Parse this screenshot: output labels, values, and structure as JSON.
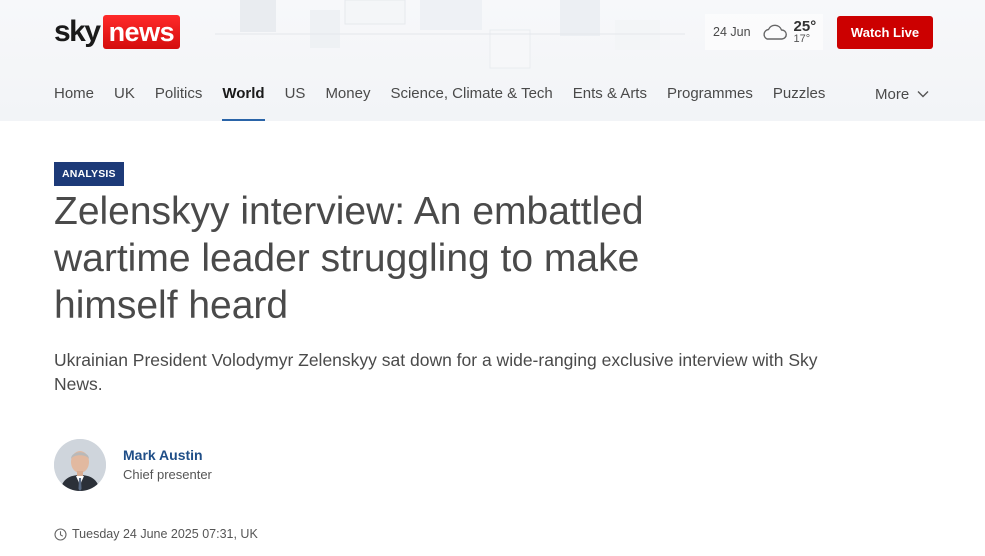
{
  "brand": {
    "logo_sky": "sky",
    "logo_news": "news",
    "accent_red": "#cc0000",
    "navy": "#1d3a78"
  },
  "weather": {
    "date": "24 Jun",
    "icon": "cloud-icon",
    "high": "25°",
    "low": "17°"
  },
  "header": {
    "watch_live_label": "Watch Live"
  },
  "nav": {
    "items": [
      {
        "label": "Home"
      },
      {
        "label": "UK"
      },
      {
        "label": "Politics"
      },
      {
        "label": "World",
        "active": true
      },
      {
        "label": "US"
      },
      {
        "label": "Money"
      },
      {
        "label": "Science, Climate & Tech"
      },
      {
        "label": "Ents & Arts"
      },
      {
        "label": "Programmes"
      },
      {
        "label": "Puzzles"
      }
    ],
    "more_label": "More"
  },
  "article": {
    "badge": "ANALYSIS",
    "headline": "Zelenskyy interview: An embattled wartime leader struggling to make himself heard",
    "standfirst": "Ukrainian President Volodymyr Zelenskyy sat down for a wide-ranging exclusive interview with Sky News.",
    "author": {
      "name": "Mark Austin",
      "role": "Chief presenter"
    },
    "timestamp": "Tuesday 24 June 2025 07:31, UK"
  }
}
